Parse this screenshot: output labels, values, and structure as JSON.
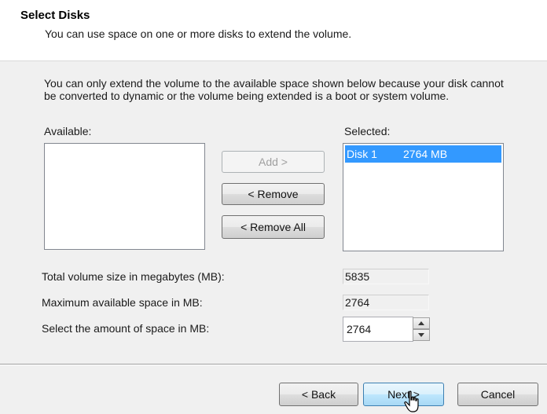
{
  "header": {
    "title": "Select Disks",
    "subtitle": "You can use space on one or more disks to extend the volume."
  },
  "notice": "You can only extend the volume to the available space shown below because your disk cannot be converted to dynamic or the volume being extended is a boot or system volume.",
  "available": {
    "label": "Available:",
    "items": []
  },
  "selected": {
    "label": "Selected:",
    "items": [
      {
        "disk": "Disk 1",
        "size": "2764 MB"
      }
    ]
  },
  "buttons": {
    "add": "Add >",
    "remove": "< Remove",
    "remove_all": "< Remove All"
  },
  "fields": {
    "total_label": "Total volume size in megabytes (MB):",
    "total_value": "5835",
    "max_label": "Maximum available space in MB:",
    "max_value": "2764",
    "select_label": "Select the amount of space in MB:",
    "select_value": "2764"
  },
  "footer": {
    "back": "< Back",
    "next": "Next >",
    "cancel": "Cancel"
  },
  "colors": {
    "selection": "#3399ff",
    "header_bg": "#ffffff",
    "dialog_bg": "#f0f0f0"
  }
}
